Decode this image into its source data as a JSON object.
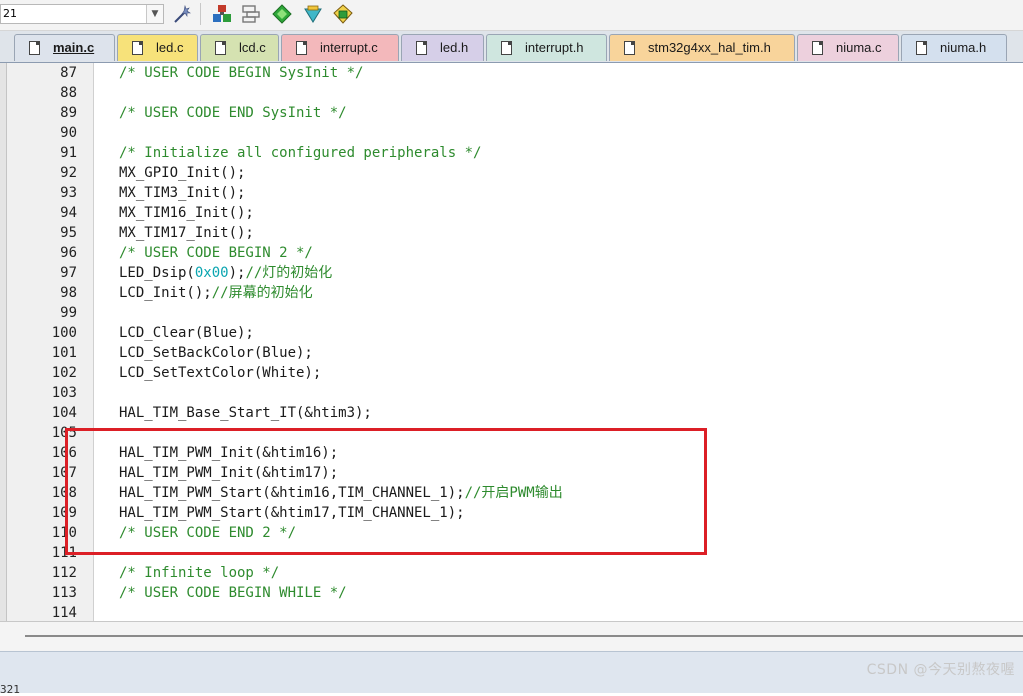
{
  "toolbar": {
    "target_value": "21",
    "dropdown_icon": "chevron-down-icon",
    "icons": [
      "wand-icon",
      "manage-components-icon",
      "window-layout-icon",
      "pack-installer-icon",
      "select-device-icon",
      "software-packs-icon"
    ]
  },
  "tabs": [
    {
      "label": "main.c",
      "color": "#dde3ec",
      "active": true
    },
    {
      "label": "led.c",
      "color": "#f7e27a",
      "active": false
    },
    {
      "label": "lcd.c",
      "color": "#d5e2b1",
      "active": false
    },
    {
      "label": "interrupt.c",
      "color": "#f3b8bb",
      "active": false
    },
    {
      "label": "led.h",
      "color": "#d6cfe8",
      "active": false
    },
    {
      "label": "interrupt.h",
      "color": "#cfe6df",
      "active": false
    },
    {
      "label": "stm32g4xx_hal_tim.h",
      "color": "#f8d49b",
      "active": false
    },
    {
      "label": "niuma.c",
      "color": "#edd0dd",
      "active": false
    },
    {
      "label": "niuma.h",
      "color": "#d4e0ee",
      "active": false
    }
  ],
  "lines": [
    {
      "num": "87",
      "parts": [
        {
          "t": "/* USER CODE BEGIN SysInit */",
          "c": "comment"
        }
      ]
    },
    {
      "num": "88",
      "parts": []
    },
    {
      "num": "89",
      "parts": [
        {
          "t": "/* USER CODE END SysInit */",
          "c": "comment"
        }
      ]
    },
    {
      "num": "90",
      "parts": []
    },
    {
      "num": "91",
      "parts": [
        {
          "t": "/* Initialize all configured peripherals */",
          "c": "comment"
        }
      ]
    },
    {
      "num": "92",
      "parts": [
        {
          "t": "MX_GPIO_Init();",
          "c": "code"
        }
      ]
    },
    {
      "num": "93",
      "parts": [
        {
          "t": "MX_TIM3_Init();",
          "c": "code"
        }
      ]
    },
    {
      "num": "94",
      "parts": [
        {
          "t": "MX_TIM16_Init();",
          "c": "code"
        }
      ]
    },
    {
      "num": "95",
      "parts": [
        {
          "t": "MX_TIM17_Init();",
          "c": "code"
        }
      ]
    },
    {
      "num": "96",
      "parts": [
        {
          "t": "/* USER CODE BEGIN 2 */",
          "c": "comment"
        }
      ]
    },
    {
      "num": "97",
      "parts": [
        {
          "t": "LED_Dsip(",
          "c": "code"
        },
        {
          "t": "0x00",
          "c": "num"
        },
        {
          "t": ");",
          "c": "code"
        },
        {
          "t": "//灯的初始化",
          "c": "comment"
        }
      ]
    },
    {
      "num": "98",
      "parts": [
        {
          "t": "LCD_Init();",
          "c": "code"
        },
        {
          "t": "//屏幕的初始化",
          "c": "comment"
        }
      ]
    },
    {
      "num": "99",
      "parts": []
    },
    {
      "num": "100",
      "parts": [
        {
          "t": "LCD_Clear(Blue);",
          "c": "code"
        }
      ]
    },
    {
      "num": "101",
      "parts": [
        {
          "t": "LCD_SetBackColor(Blue);",
          "c": "code"
        }
      ]
    },
    {
      "num": "102",
      "parts": [
        {
          "t": "LCD_SetTextColor(White);",
          "c": "code"
        }
      ]
    },
    {
      "num": "103",
      "parts": []
    },
    {
      "num": "104",
      "parts": [
        {
          "t": "HAL_TIM_Base_Start_IT(&htim3);",
          "c": "code"
        }
      ]
    },
    {
      "num": "105",
      "parts": []
    },
    {
      "num": "106",
      "parts": [
        {
          "t": "HAL_TIM_PWM_Init(&htim16);",
          "c": "code"
        }
      ]
    },
    {
      "num": "107",
      "parts": [
        {
          "t": "HAL_TIM_PWM_Init(&htim17);",
          "c": "code"
        }
      ]
    },
    {
      "num": "108",
      "parts": [
        {
          "t": "HAL_TIM_PWM_Start(&htim16,TIM_CHANNEL_1);",
          "c": "code"
        },
        {
          "t": "//开启PWM输出",
          "c": "comment"
        }
      ]
    },
    {
      "num": "109",
      "parts": [
        {
          "t": "HAL_TIM_PWM_Start(&htim17,TIM_CHANNEL_1);",
          "c": "code"
        }
      ]
    },
    {
      "num": "110",
      "parts": [
        {
          "t": "/* USER CODE END 2 */",
          "c": "comment"
        }
      ]
    },
    {
      "num": "111",
      "parts": []
    },
    {
      "num": "112",
      "parts": [
        {
          "t": "/* Infinite loop */",
          "c": "comment"
        }
      ]
    },
    {
      "num": "113",
      "parts": [
        {
          "t": "/* USER CODE BEGIN WHILE */",
          "c": "comment"
        }
      ]
    },
    {
      "num": "114",
      "parts": []
    }
  ],
  "status": {
    "text": "321",
    "watermark": "CSDN @今天别熬夜喔"
  },
  "colors": {
    "comment": "#2e8b2e",
    "number": "#0aa5b0",
    "highlight_box": "#dc1f26"
  }
}
